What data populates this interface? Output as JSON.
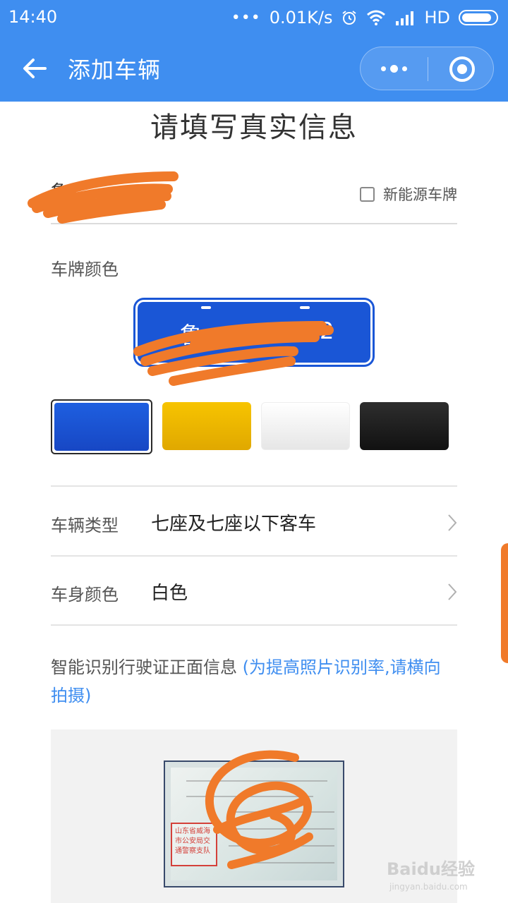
{
  "status_bar": {
    "time": "14:40",
    "dots": "•••",
    "speed": "0.01K/s",
    "network": "HD"
  },
  "title_bar": {
    "title": "添加车辆",
    "background_color": "#3f8ef0"
  },
  "heading": "请填写真实信息",
  "plate": {
    "number_prefix": "鲁K",
    "new_energy_label": "新能源车牌",
    "new_energy_checked": false
  },
  "plate_color": {
    "label": "车牌颜色",
    "preview_text": "鲁",
    "preview_suffix": "2",
    "swatches": [
      {
        "name": "blue",
        "color": "#1a56d6",
        "selected": true
      },
      {
        "name": "yellow",
        "color": "#f2b705",
        "selected": false
      },
      {
        "name": "white",
        "color": "#f1f1f1",
        "selected": false
      },
      {
        "name": "black",
        "color": "#1d1d1d",
        "selected": false
      }
    ]
  },
  "vehicle_type": {
    "label": "车辆类型",
    "value": "七座及七座以下客车"
  },
  "body_color": {
    "label": "车身颜色",
    "value": "白色"
  },
  "ocr": {
    "text": "智能识别行驶证正面信息 ",
    "hint": "(为提高照片识别率,请横向拍摄)"
  },
  "license_photo": {
    "stamp_text": "山东省威海市公安局交通警察支队"
  },
  "watermark": {
    "text": "Baidu经验",
    "sub": "jingyan.baidu.com"
  },
  "colors": {
    "accent": "#3f8ef0",
    "redaction": "#f07a2a"
  }
}
